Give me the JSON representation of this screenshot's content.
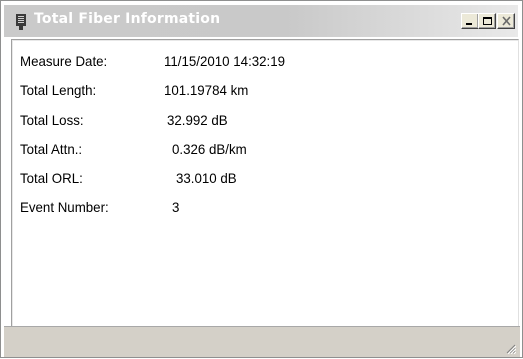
{
  "window": {
    "title": "Total Fiber Information",
    "buttons": {
      "minimize": "minimize",
      "maximize": "maximize",
      "close": "close"
    }
  },
  "info": {
    "rows": [
      {
        "label": "Measure Date:",
        "value": "11/15/2010 14:32:19"
      },
      {
        "label": "Total Length:",
        "value": "101.19784 km"
      },
      {
        "label": "Total Loss:",
        "value": "32.992 dB"
      },
      {
        "label": "Total Attn.:",
        "value": "0.326 dB/km"
      },
      {
        "label": "Total ORL:",
        "value": "33.010 dB"
      },
      {
        "label": "Event Number:",
        "value": "3"
      }
    ]
  },
  "icons": {
    "title_icon": "window-fiber-icon",
    "minimize": "minimize-icon",
    "maximize": "maximize-icon",
    "close": "close-icon",
    "grip": "resize-grip-icon"
  },
  "colors": {
    "title_bar": "#c9c9c9",
    "title_text": "#ffffff",
    "status_bar": "#d4d0c8"
  }
}
